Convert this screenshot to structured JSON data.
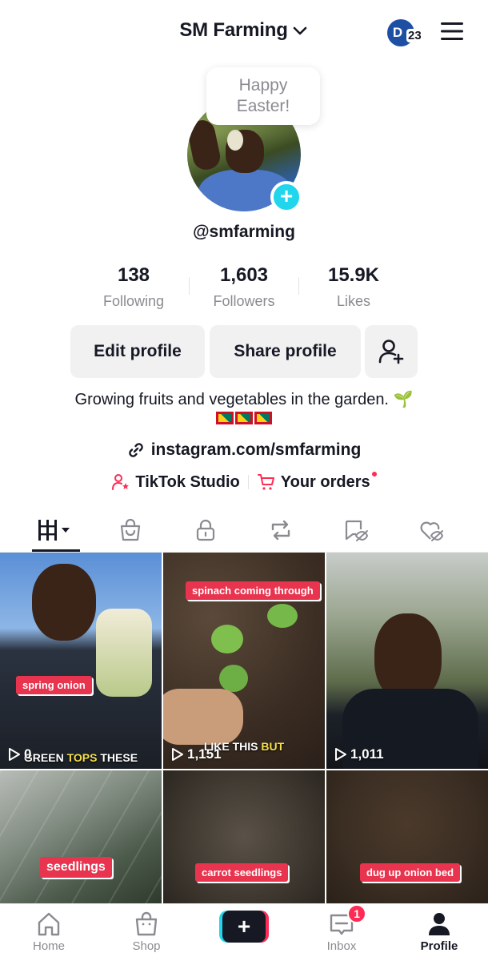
{
  "header": {
    "title": "SM Farming",
    "account_initial": "D",
    "account_count": "23"
  },
  "profile": {
    "bubble_line1": "Happy",
    "bubble_line2": "Easter!",
    "username": "@smfarming",
    "stats": {
      "following_value": "138",
      "following_label": "Following",
      "followers_value": "1,603",
      "followers_label": "Followers",
      "likes_value": "15.9K",
      "likes_label": "Likes"
    },
    "edit_label": "Edit profile",
    "share_label": "Share profile",
    "bio": "Growing fruits and vegetables in the garden. 🌱",
    "link": "instagram.com/smfarming",
    "studio_label": "TikTok Studio",
    "orders_label": "Your orders"
  },
  "tabs": [
    "videos-grid-icon",
    "shop-bag-icon",
    "lock-icon",
    "repost-icon",
    "tagged-icon",
    "liked-icon"
  ],
  "videos": [
    {
      "caption": "spring onion",
      "views": "0",
      "subtitle_pre": "GREEN ",
      "subtitle_hl": "TOPS",
      "subtitle_post": " THESE"
    },
    {
      "caption": "spinach coming through",
      "views": "1,151",
      "subtitle_pre": "LIKE THIS ",
      "subtitle_hl": "BUT",
      "subtitle_post": ""
    },
    {
      "caption": "",
      "views": "1,011",
      "subtitle_pre": "",
      "subtitle_hl": "",
      "subtitle_post": ""
    },
    {
      "caption": "seedlings",
      "views": "",
      "subtitle_pre": "",
      "subtitle_hl": "",
      "subtitle_post": ""
    },
    {
      "caption": "carrot seedlings",
      "views": "",
      "subtitle_pre": "",
      "subtitle_hl": "",
      "subtitle_post": ""
    },
    {
      "caption": "dug up onion bed",
      "views": "",
      "subtitle_pre": "",
      "subtitle_hl": "",
      "subtitle_post": ""
    }
  ],
  "nav": {
    "home": "Home",
    "shop": "Shop",
    "create": "+",
    "inbox": "Inbox",
    "inbox_badge": "1",
    "profile": "Profile"
  },
  "colors": {
    "accent_red": "#fe2c55",
    "accent_cyan": "#20d5ec",
    "caption_red": "#e8344e"
  }
}
